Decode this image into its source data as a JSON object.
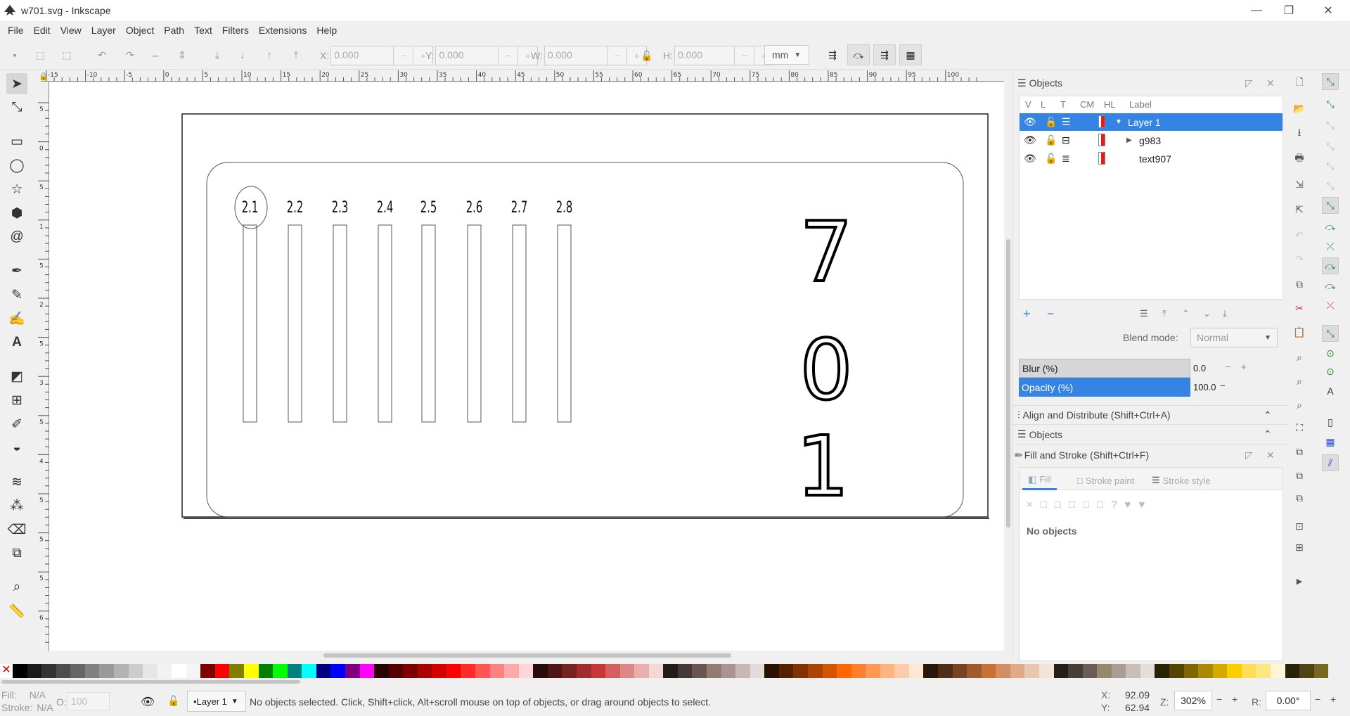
{
  "window": {
    "title": "w701.svg - Inkscape"
  },
  "menu": [
    "File",
    "Edit",
    "View",
    "Layer",
    "Object",
    "Path",
    "Text",
    "Filters",
    "Extensions",
    "Help"
  ],
  "toolbar": {
    "x_label": "X:",
    "x_value": "0.000",
    "y_label": "Y:",
    "y_value": "0.000",
    "w_label": "W:",
    "w_value": "0.000",
    "h_label": "H:",
    "h_value": "0.000",
    "unit": "mm"
  },
  "ruler": {
    "top_labels": [
      "-15",
      "-10",
      "-5",
      "0",
      "5",
      "10",
      "15",
      "20",
      "25",
      "30",
      "35",
      "40",
      "45",
      "50",
      "55",
      "60",
      "65",
      "70",
      "75",
      "80",
      "85",
      "90",
      "95",
      "100"
    ],
    "left_labels": [
      "5",
      "0",
      "5",
      "1",
      "5",
      "2",
      "5",
      "3",
      "5",
      "4",
      "5",
      "5",
      "5",
      "6",
      "5"
    ]
  },
  "drawing": {
    "labels": [
      "2.1",
      "2.2",
      "2.3",
      "2.4",
      "2.5",
      "2.6",
      "2.7",
      "2.8"
    ],
    "digits": [
      "7",
      "0",
      "1"
    ]
  },
  "objects_panel": {
    "title": "Objects",
    "columns": [
      "V",
      "L",
      "T",
      "CM",
      "HL",
      "Label"
    ],
    "rows": [
      {
        "label": "Layer 1",
        "selected": true,
        "expander": "open"
      },
      {
        "label": "g983",
        "selected": false,
        "expander": "closed"
      },
      {
        "label": "text907",
        "selected": false,
        "expander": "none"
      }
    ],
    "blend_mode_label": "Blend mode:",
    "blend_mode_value": "Normal",
    "blur_label": "Blur (%)",
    "blur_value": "0.0",
    "opacity_label": "Opacity (%)",
    "opacity_value": "100.0"
  },
  "docked": {
    "align": "Align and Distribute (Shift+Ctrl+A)",
    "objects": "Objects",
    "fill_stroke": "Fill and Stroke (Shift+Ctrl+F)"
  },
  "fill_stroke": {
    "tabs": [
      "Fill",
      "Stroke paint",
      "Stroke style"
    ],
    "status": "No objects",
    "paint_types": [
      "×",
      "□",
      "□",
      "□",
      "□",
      "□",
      "?",
      "♥",
      "♥"
    ]
  },
  "status": {
    "fill_label": "Fill:",
    "fill_value": "N/A",
    "stroke_label": "Stroke:",
    "stroke_value": "N/A",
    "opacity_label": "O:",
    "opacity_value": "100",
    "layer": "•Layer 1",
    "message": "No objects selected. Click, Shift+click, Alt+scroll mouse on top of objects, or drag around objects to select.",
    "x_label": "X:",
    "x_value": "92.09",
    "y_label": "Y:",
    "y_value": "62.94",
    "zoom_label": "Z:",
    "zoom_value": "302%",
    "rotation_label": "R:",
    "rotation_value": "0.00°"
  },
  "palette_colors": [
    "#000000",
    "#1a1a1a",
    "#333333",
    "#4d4d4d",
    "#666666",
    "#808080",
    "#999999",
    "#b3b3b3",
    "#cccccc",
    "#e6e6e6",
    "#f2f2f2",
    "#ffffff",
    "#f5f5f5",
    "#800000",
    "#ff0000",
    "#808000",
    "#ffff00",
    "#008000",
    "#00ff00",
    "#008080",
    "#00ffff",
    "#000080",
    "#0000ff",
    "#800080",
    "#ff00ff",
    "#2b0000",
    "#550000",
    "#800000",
    "#aa0000",
    "#d40000",
    "#ff0000",
    "#ff2a2a",
    "#ff5555",
    "#ff8080",
    "#ffaaaa",
    "#ffd5d5",
    "#280b0b",
    "#501616",
    "#782121",
    "#a02c2c",
    "#c83737",
    "#d35f5f",
    "#de8787",
    "#e9afaf",
    "#f4d7d7",
    "#241c1c",
    "#483737",
    "#6c5353",
    "#917c6f",
    "#ac9393",
    "#c8b7b7",
    "#e3dbdb",
    "#2b1100",
    "#552200",
    "#803300",
    "#aa4400",
    "#d45500",
    "#ff6600",
    "#ff7f2a",
    "#ff9955",
    "#ffb380",
    "#ffccaa",
    "#ffe6d5",
    "#28170b",
    "#502d16",
    "#784421",
    "#a05a2c",
    "#c87137",
    "#d38d5f",
    "#deaa87",
    "#e9c6af",
    "#f4e3d7",
    "#241f1c",
    "#483e37",
    "#6c5d53",
    "#918a6f",
    "#ac9d93",
    "#c8beb7",
    "#e3dedb",
    "#2b2200",
    "#554400",
    "#806600",
    "#aa8800",
    "#d4aa00",
    "#ffcc00",
    "#ffdd55",
    "#ffe680",
    "#fff6d5",
    "#28220b",
    "#504416",
    "#786721"
  ]
}
